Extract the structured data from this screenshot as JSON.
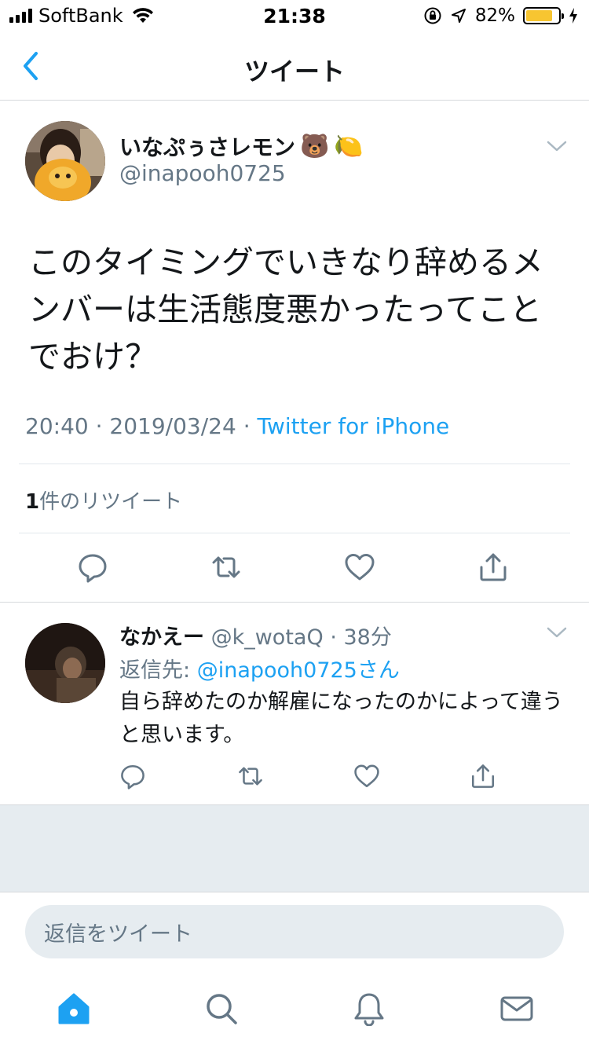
{
  "status_bar": {
    "carrier": "SoftBank",
    "time": "21:38",
    "battery_percent": "82%",
    "battery_level": 0.82,
    "battery_color": "#f7c531"
  },
  "nav": {
    "title": "ツイート",
    "back_icon": "chevron-left-icon"
  },
  "tweet": {
    "author_name": "いなぷぅさレモン",
    "author_emoji": [
      "🐻",
      "🍋"
    ],
    "author_handle": "@inapooh0725",
    "text": "このタイミングでいきなり辞めるメンバーは生活態度悪かったってことでおけ？",
    "time": "20:40",
    "date": "2019/03/24",
    "separator": "·",
    "source": "Twitter for iPhone",
    "retweet_count": "1",
    "retweet_label": "件のリツイート"
  },
  "reply": {
    "name": "なかえー",
    "handle": "@k_wotaQ",
    "separator": "·",
    "time": "38分",
    "reply_to_label": "返信先:",
    "reply_to_mention": "@inapooh0725さん",
    "text": "自ら辞めたのか解雇になったのかによって違うと思います。"
  },
  "compose": {
    "placeholder": "返信をツイート"
  },
  "tabs": [
    "home-icon",
    "search-icon",
    "notifications-icon",
    "messages-icon"
  ],
  "colors": {
    "accent": "#1da1f2",
    "text": "#14171a",
    "muted": "#657786",
    "divider": "#e1e8ed",
    "background_grey": "#e6ecf0"
  }
}
